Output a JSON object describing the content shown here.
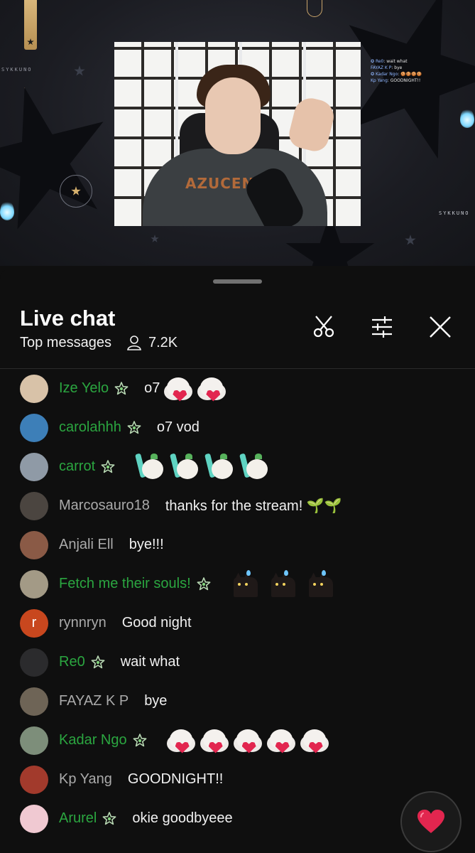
{
  "stream": {
    "overlay_chat": [
      {
        "name": "Re0",
        "text": "wait what"
      },
      {
        "name": "FAYAZ K P",
        "text": "bye"
      },
      {
        "name": "Kadar Ngo",
        "text": "🍪🍪🍪🍪"
      },
      {
        "name": "Kp Yang",
        "text": "GOODNIGHT!!"
      }
    ],
    "brand_left": "SYKKUNO",
    "brand_right": "SYKKUNO",
    "shirt_text": "AZUCENA"
  },
  "chat": {
    "title": "Live chat",
    "mode_label": "Top messages",
    "viewer_count": "7.2K",
    "colors": {
      "member_name": "#2ba640",
      "plain_name": "#aaaaaa",
      "accent_heart": "#e2264f"
    },
    "messages": [
      {
        "author": "Ize Yelo",
        "member": true,
        "text": "o7",
        "emotes": [
          "sheep-heart",
          "sheep-heart"
        ],
        "avatar_color": "#d8c2a8"
      },
      {
        "author": "carolahhh",
        "member": true,
        "text": "o7 vod",
        "emotes": [],
        "avatar_color": "#3d7fb8"
      },
      {
        "author": "carrot",
        "member": true,
        "text": "",
        "emotes": [
          "sheep-sword",
          "sheep-sword",
          "sheep-sword",
          "sheep-sword"
        ],
        "avatar_color": "#8f9aa6"
      },
      {
        "author": "Marcosauro18",
        "member": false,
        "text": "thanks for the stream! 🌱🌱",
        "emotes": [],
        "avatar_color": "#4b4540"
      },
      {
        "author": "Anjali Ell",
        "member": false,
        "text": "bye!!!",
        "emotes": [],
        "avatar_color": "#8a5a46"
      },
      {
        "author": "Fetch me their souls!",
        "member": true,
        "text": "",
        "emotes": [
          "black-cat",
          "black-cat",
          "black-cat"
        ],
        "avatar_color": "#a39a86"
      },
      {
        "author": "rynnryn",
        "member": false,
        "text": "Good night",
        "emotes": [],
        "avatar_color": "#c8471e",
        "avatar_letter": "r"
      },
      {
        "author": "Re0",
        "member": true,
        "text": "wait what",
        "emotes": [],
        "avatar_color": "#2b2b2d"
      },
      {
        "author": "FAYAZ K P",
        "member": false,
        "text": "bye",
        "emotes": [],
        "avatar_color": "#6e6456"
      },
      {
        "author": "Kadar Ngo",
        "member": true,
        "text": "",
        "emotes": [
          "sheep-heart",
          "sheep-heart",
          "sheep-heart",
          "sheep-heart",
          "sheep-heart"
        ],
        "avatar_color": "#7d8e7a"
      },
      {
        "author": "Kp Yang",
        "member": false,
        "text": "GOODNIGHT!!",
        "emotes": [],
        "avatar_color": "#a23a2c"
      },
      {
        "author": "Arurel",
        "member": true,
        "text": "okie goodbyeee",
        "emotes": [],
        "avatar_color": "#f0c9d2"
      }
    ]
  },
  "icons": {
    "clip": "scissors-icon",
    "filter": "sliders-icon",
    "close": "close-icon",
    "viewers": "person-icon",
    "member_badge": "star-badge-icon",
    "heart_reaction": "heart-icon"
  }
}
